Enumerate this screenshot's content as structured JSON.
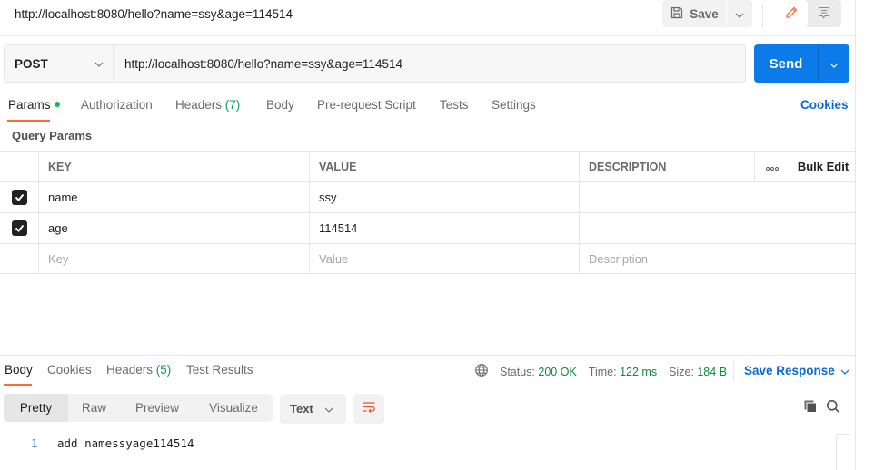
{
  "header": {
    "title": "http://localhost:8080/hello?name=ssy&age=114514",
    "save_label": "Save",
    "icons": {
      "save": "save-floppy-icon",
      "edit": "pencil-icon",
      "comments": "comment-icon"
    }
  },
  "request": {
    "method": "POST",
    "url": "http://localhost:8080/hello?name=ssy&age=114514",
    "send_label": "Send",
    "accent_color": "#0c7ae8"
  },
  "tabs": {
    "items": [
      {
        "label": "Params",
        "active": true,
        "indicator": "green-dot"
      },
      {
        "label": "Authorization"
      },
      {
        "label": "Headers",
        "count": "(7)"
      },
      {
        "label": "Body"
      },
      {
        "label": "Pre-request Script"
      },
      {
        "label": "Tests"
      },
      {
        "label": "Settings"
      }
    ],
    "cookies_label": "Cookies",
    "active_underline_color": "#ff6c37"
  },
  "params": {
    "section_label": "Query Params",
    "columns": {
      "key": "KEY",
      "value": "VALUE",
      "description": "DESCRIPTION",
      "more": "•••",
      "bulk_edit": "Bulk Edit"
    },
    "rows": [
      {
        "checked": true,
        "key": "name",
        "value": "ssy",
        "description": ""
      },
      {
        "checked": true,
        "key": "age",
        "value": "114514",
        "description": ""
      }
    ],
    "placeholders": {
      "key": "Key",
      "value": "Value",
      "description": "Description"
    }
  },
  "response": {
    "tabs": [
      {
        "label": "Body",
        "active": true
      },
      {
        "label": "Cookies"
      },
      {
        "label": "Headers",
        "count": "(5)"
      },
      {
        "label": "Test Results"
      }
    ],
    "status": {
      "label": "Status:",
      "value": "200 OK"
    },
    "time": {
      "label": "Time:",
      "value": "122 ms"
    },
    "size": {
      "label": "Size:",
      "value": "184 B"
    },
    "save_response_label": "Save Response",
    "view_modes": [
      "Pretty",
      "Raw",
      "Preview",
      "Visualize"
    ],
    "active_view": "Pretty",
    "format": "Text",
    "body_lines": [
      {
        "number": "1",
        "text": "add namessyage114514"
      }
    ]
  }
}
